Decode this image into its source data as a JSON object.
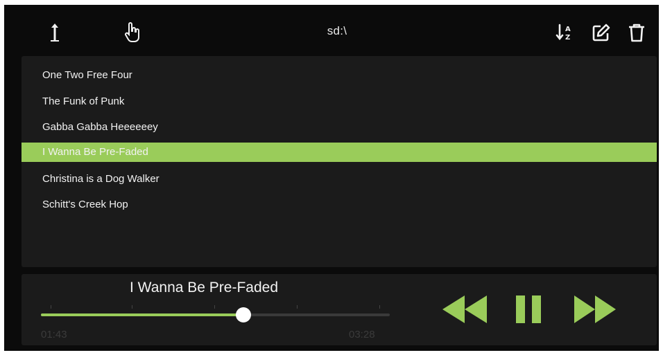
{
  "toolbar": {
    "path": "sd:\\",
    "icons": [
      "upload-icon",
      "hand-pointer-icon",
      "sort-az-icon",
      "edit-icon",
      "trash-icon"
    ]
  },
  "files": [
    {
      "name": "One Two Free Four",
      "selected": false
    },
    {
      "name": "The Funk of Punk",
      "selected": false
    },
    {
      "name": "Gabba Gabba Heeeeeey",
      "selected": false
    },
    {
      "name": "I Wanna Be Pre-Faded",
      "selected": true
    },
    {
      "name": "Christina is a Dog Walker",
      "selected": false
    },
    {
      "name": "Schitt's Creek Hop",
      "selected": false
    }
  ],
  "player": {
    "title": "I Wanna Be Pre-Faded",
    "elapsed": "01:43",
    "duration": "03:28",
    "progress": 0.58,
    "state": "playing",
    "controls": [
      "rewind-icon",
      "pause-icon",
      "fast-forward-icon"
    ]
  },
  "colors": {
    "accent": "#9acc5a",
    "background": "#0b0b0b",
    "panel": "#1b1b1b",
    "text": "#f2f2f2"
  }
}
